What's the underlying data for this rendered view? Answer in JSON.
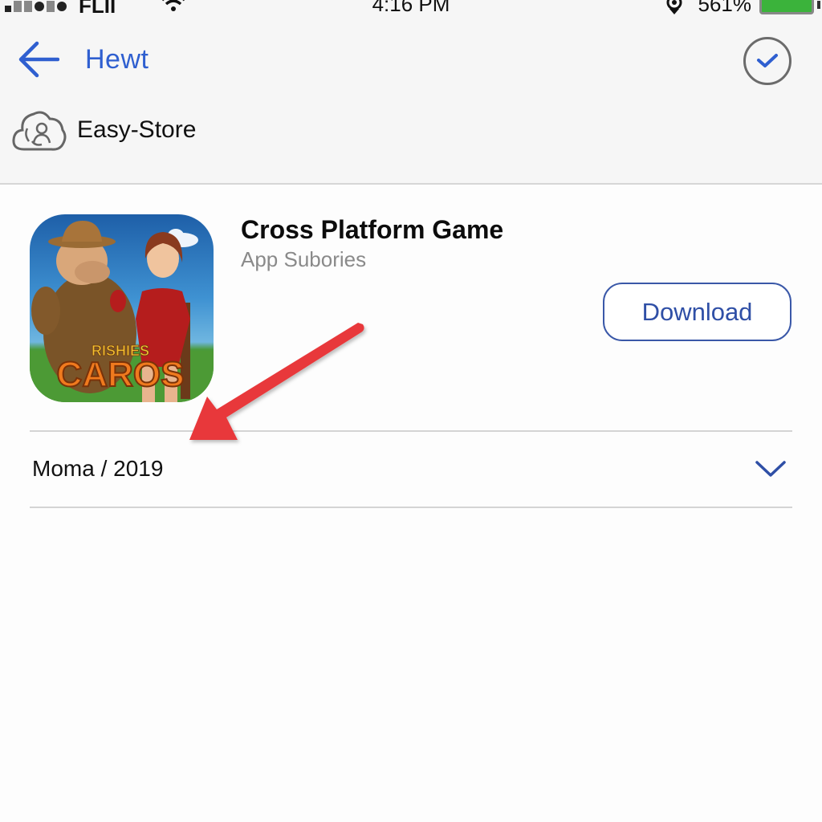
{
  "status_bar": {
    "carrier": "FLII",
    "time": "4:16 PM",
    "battery_percent": "561%",
    "battery_color": "#3bb33b"
  },
  "header": {
    "back_label": "Hewt",
    "back_icon": "arrow-left-icon",
    "confirm_icon": "checkmark-circle-icon",
    "store_logo_icon": "cloud-user-icon",
    "store_name": "Easy-Store",
    "accent_color": "#2f5fd0"
  },
  "app": {
    "title": "Cross Platform Game",
    "subtitle": "App Subories",
    "icon_caption_small": "RISHIES",
    "icon_caption_large": "CAROS",
    "download_label": "Download"
  },
  "details": {
    "dropdown_value": "Moma / 2019",
    "dropdown_icon": "chevron-down-icon"
  },
  "annotation": {
    "arrow_color": "#e8393a",
    "arrow_icon": "red-pointer-arrow"
  }
}
